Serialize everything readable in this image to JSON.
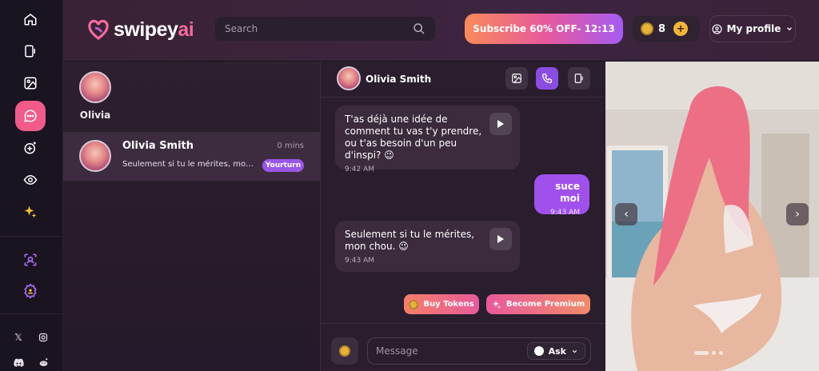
{
  "brand": {
    "name_main": "swipey",
    "name_accent": "ai",
    "accent_color": "#f26b9b"
  },
  "header": {
    "search_placeholder": "Search",
    "subscribe_label": "Subscribe 60% OFF- 12:13",
    "token_count": "8",
    "profile_label": "My profile"
  },
  "sidebar": {
    "items": [
      {
        "icon": "home-icon"
      },
      {
        "icon": "video-icon"
      },
      {
        "icon": "gallery-icon"
      },
      {
        "icon": "chat-icon",
        "active": true
      },
      {
        "icon": "create-icon"
      },
      {
        "icon": "eye-icon"
      },
      {
        "icon": "sparkles-icon"
      },
      {
        "icon": "search-user-icon"
      },
      {
        "icon": "settings-icon"
      }
    ],
    "social": [
      "x-icon",
      "instagram-icon",
      "discord-icon",
      "reddit-icon"
    ]
  },
  "conversations": {
    "story_name": "Olivia",
    "items": [
      {
        "name": "Olivia Smith",
        "time": "0 mins",
        "preview": "Seulement si tu le mérites, mon chou. 😉",
        "badge": "Yourturn"
      }
    ]
  },
  "chat": {
    "contact_name": "Olivia Smith",
    "messages": [
      {
        "direction": "in",
        "text": "T'as déjà une idée de comment tu vas t'y prendre, ou t'as besoin d'un peu d'inspi? 😉",
        "time": "9:42 AM"
      },
      {
        "direction": "out",
        "text": "suce moi",
        "time": "9:43 AM"
      },
      {
        "direction": "in",
        "text": "Seulement si tu le mérites, mon chou. 😉",
        "time": "9:43 AM"
      }
    ],
    "buy_tokens_label": "Buy Tokens",
    "become_premium_label": "Become Premium",
    "message_placeholder": "Message",
    "ask_label": "Ask"
  }
}
